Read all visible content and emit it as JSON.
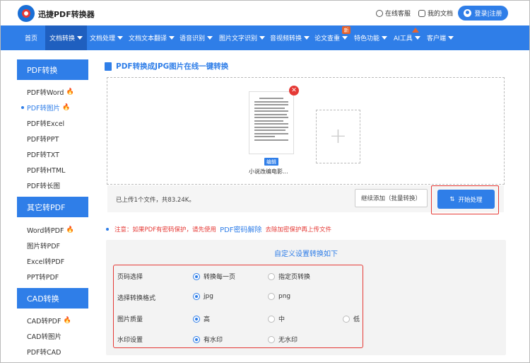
{
  "header": {
    "brand": "迅捷PDF转换器",
    "service_label": "在线客服",
    "docs_label": "我的文档",
    "login_label": "登录|注册"
  },
  "nav": {
    "items": [
      {
        "label": "首页"
      },
      {
        "label": "文档转换"
      },
      {
        "label": "文档处理"
      },
      {
        "label": "文档文本翻译"
      },
      {
        "label": "语音识别"
      },
      {
        "label": "图片文字识别"
      },
      {
        "label": "音视频转换"
      },
      {
        "label": "论文查重"
      },
      {
        "label": "特色功能"
      },
      {
        "label": "AI工具"
      },
      {
        "label": "客户端"
      }
    ],
    "new_badge": "新"
  },
  "sidebar": {
    "groups": [
      {
        "title": "PDF转换",
        "items": [
          "PDF转Word",
          "PDF转图片",
          "PDF转Excel",
          "PDF转PPT",
          "PDF转TXT",
          "PDF转HTML",
          "PDF转长图"
        ]
      },
      {
        "title": "其它转PDF",
        "items": [
          "Word转PDF",
          "图片转PDF",
          "Excel转PDF",
          "PPT转PDF"
        ]
      },
      {
        "title": "CAD转换",
        "items": [
          "CAD转PDF",
          "CAD转图片",
          "PDF转CAD"
        ]
      }
    ],
    "fire_icon": "🔥"
  },
  "main": {
    "title": "PDF转换成JPG图片在线一键转换",
    "file": {
      "edit_label": "编辑",
      "name": "小说改编电影..."
    },
    "upload_info": "已上传1个文件，共83.24K。",
    "continue_label": "继续添加（批量转换）",
    "start_label": "开始处理",
    "notice_prefix": "注意：如果PDF有密码保护，请先使用",
    "notice_link": "PDF密码解除",
    "notice_suffix": "去除加密保护再上传文件",
    "settings_title": "自定义设置转换如下",
    "settings": [
      {
        "label": "页码选择",
        "options": [
          "转换每一页",
          "指定页转换"
        ],
        "selected": 0
      },
      {
        "label": "选择转换格式",
        "options": [
          "jpg",
          "png"
        ],
        "selected": 0
      },
      {
        "label": "图片质量",
        "options": [
          "高",
          "中",
          "低"
        ],
        "selected": 0
      },
      {
        "label": "水印设置",
        "options": [
          "有水印",
          "无水印"
        ],
        "selected": 0
      }
    ]
  },
  "colors": {
    "accent": "#2f7ee8",
    "highlight": "#e53935"
  }
}
